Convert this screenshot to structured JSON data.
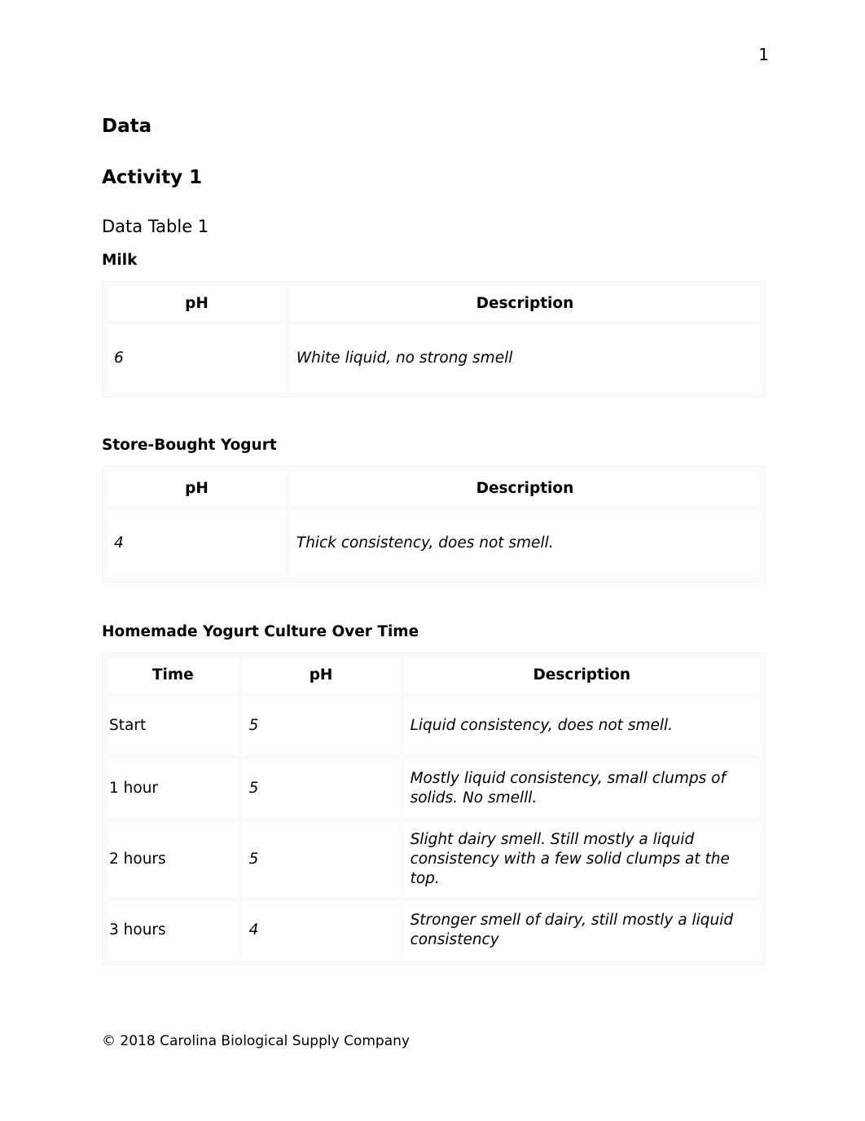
{
  "page": {
    "number": "1"
  },
  "headings": {
    "data": "Data",
    "activity": "Activity 1",
    "data_table_label": "Data Table 1"
  },
  "colors": {
    "value_blue": "#2E74B5",
    "text_black": "#000000",
    "table_gap": "#fafafa"
  },
  "tables": {
    "milk": {
      "caption": "Milk",
      "columns": [
        "pH",
        "Description"
      ],
      "rows": [
        {
          "ph": "6",
          "description": "White liquid, no strong smell"
        }
      ]
    },
    "store_bought": {
      "caption": "Store-Bought Yogurt",
      "columns": [
        "pH",
        "Description"
      ],
      "rows": [
        {
          "ph": "4",
          "description": "Thick consistency, does not smell."
        }
      ]
    },
    "homemade": {
      "caption": "Homemade Yogurt Culture Over Time",
      "columns": [
        "Time",
        "pH",
        "Description"
      ],
      "rows": [
        {
          "time": "Start",
          "ph": "5",
          "description": "Liquid consistency, does not smell."
        },
        {
          "time": "1 hour",
          "ph": "5",
          "description": "Mostly liquid consistency, small clumps of solids. No smelll."
        },
        {
          "time": "2 hours",
          "ph": "5",
          "description": "Slight dairy smell. Still mostly a liquid consistency with a few solid clumps at the top."
        },
        {
          "time": "3 hours",
          "ph": "4",
          "description": "Stronger smell of dairy, still mostly a liquid consistency"
        }
      ]
    }
  },
  "footer": {
    "copyright": "© 2018 Carolina Biological Supply Company"
  }
}
